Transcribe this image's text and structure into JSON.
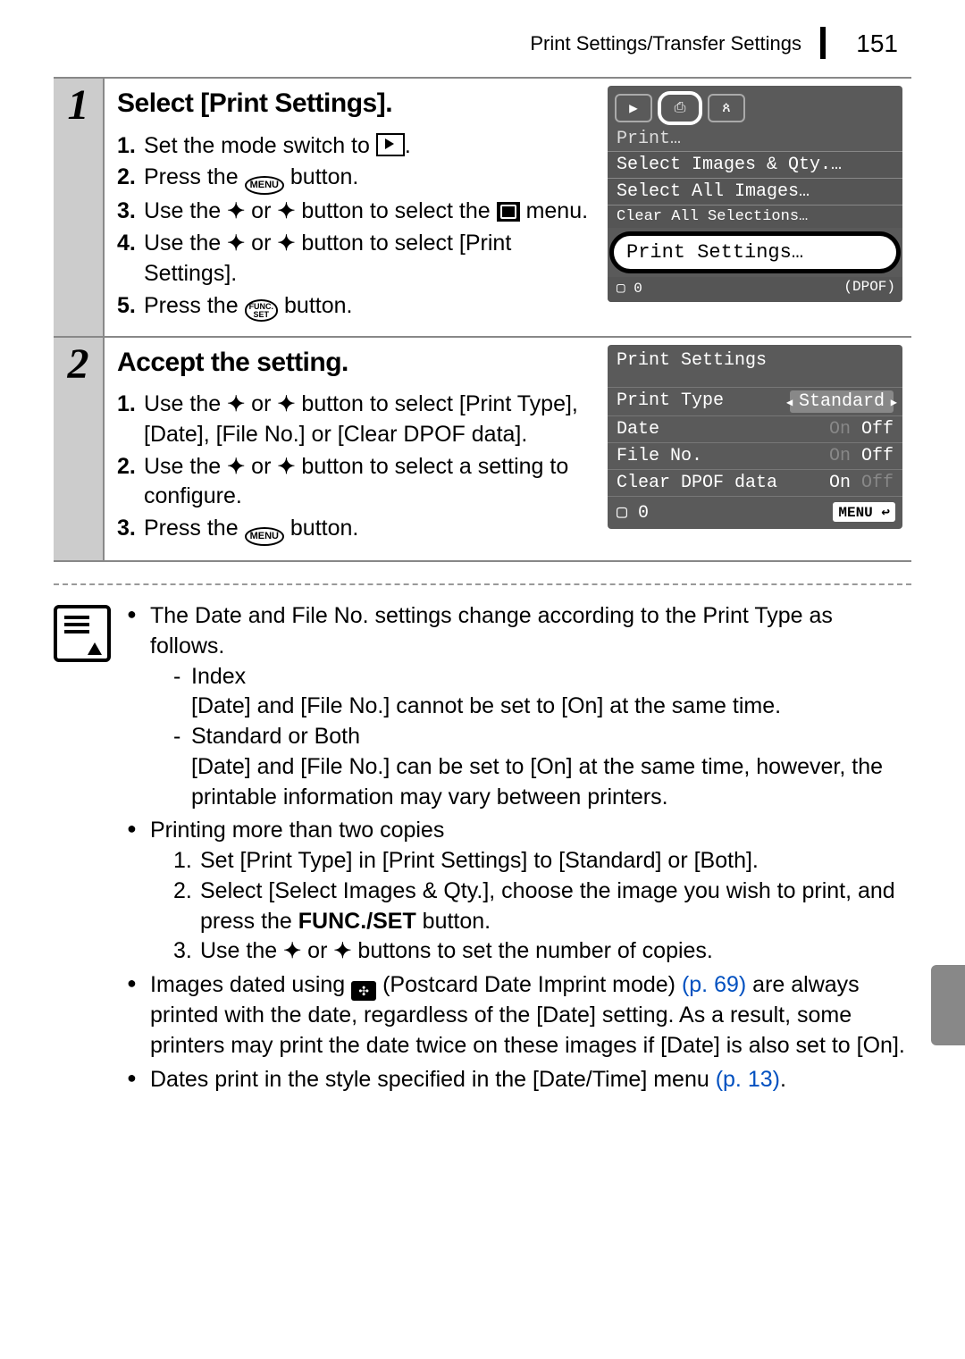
{
  "header": {
    "breadcrumb": "Print Settings/Transfer Settings",
    "page": "151"
  },
  "step1": {
    "num": "1",
    "title": "Select [Print Settings].",
    "sub1_n": "1.",
    "sub1_t": "Set the mode switch to ",
    "sub2_n": "2.",
    "sub2_a": "Press the ",
    "sub2_b": " button.",
    "menu_btn": "MENU",
    "sub3_n": "3.",
    "sub3_a": "Use the ",
    "sub3_b": " or ",
    "sub3_c": " button to select the ",
    "sub3_d": " menu.",
    "sub4_n": "4.",
    "sub4_a": "Use the ",
    "sub4_b": " or ",
    "sub4_c": " button to select [Print Settings].",
    "sub5_n": "5.",
    "sub5_a": "Press the ",
    "sub5_b": " button.",
    "func_top": "FUNC.",
    "func_bot": "SET"
  },
  "shot1": {
    "print_label": "Print…",
    "m1": "Select Images & Qty.…",
    "m2": "Select All Images…",
    "m3": "Clear All Selections…",
    "m4": "Print Settings…",
    "foot_left": "▢ 0",
    "foot_right": "(DPOF)"
  },
  "step2": {
    "num": "2",
    "title": "Accept the setting.",
    "sub1_n": "1.",
    "sub1_a": "Use the ",
    "sub1_b": " or ",
    "sub1_c": " button to select [Print Type], [Date], [File No.] or [Clear DPOF data].",
    "sub2_n": "2.",
    "sub2_a": "Use the ",
    "sub2_b": " or ",
    "sub2_c": " button to select a setting to configure.",
    "sub3_n": "3.",
    "sub3_a": "Press the ",
    "sub3_b": " button.",
    "menu_btn": "MENU"
  },
  "shot2": {
    "title": "Print Settings",
    "r1_label": "Print Type",
    "r1_val": "Standard",
    "r2_label": "Date",
    "r2_on": "On",
    "r2_off": "Off",
    "r3_label": "File No.",
    "r3_on": "On",
    "r3_off": "Off",
    "r4_label": "Clear DPOF data",
    "r4_on": "On",
    "r4_off": "Off",
    "foot_left": "▢ 0",
    "foot_menu": "MENU ↩"
  },
  "notes": {
    "b1_a": "The Date and File No. settings change according to the Print Type as follows.",
    "b1_s1_t": "Index",
    "b1_s1_d": "[Date] and [File No.] cannot be set to [On] at the same time.",
    "b1_s2_t": "Standard or Both",
    "b1_s2_d": "[Date] and [File No.] can be set to [On] at the same time, however, the printable information may vary between printers.",
    "b2_t": "Printing more than two copies",
    "b2_1": "Set [Print Type] in [Print Settings] to [Standard] or [Both].",
    "b2_2a": "Select [Select Images & Qty.], choose the image you wish to print, and press the ",
    "b2_2b": "FUNC./SET",
    "b2_2c": " button.",
    "b2_3a": "Use the ",
    "b2_3b": " or ",
    "b2_3c": " buttons to set the number of copies.",
    "b3_a": "Images dated using ",
    "b3_b": " (Postcard Date Imprint mode) ",
    "b3_link": "(p. 69)",
    "b3_c": " are always printed with the date, regardless of the [Date] setting. As a result, some printers may print the date twice on these images if [Date] is also set to [On].",
    "b4_a": "Dates print in the style specified in the [Date/Time] menu ",
    "b4_link": "(p. 13)",
    "b4_b": "."
  }
}
